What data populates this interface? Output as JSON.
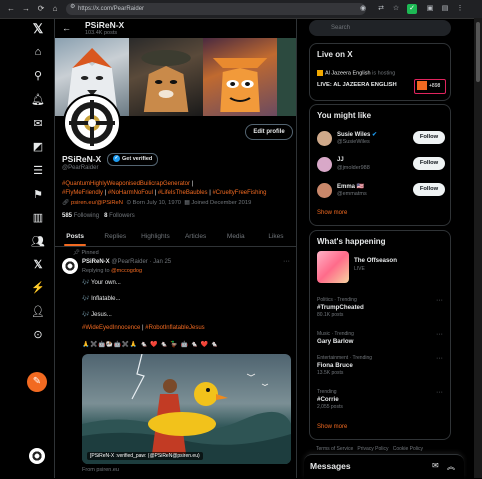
{
  "browser": {
    "url": "https://x.com/PearRaider"
  },
  "header": {
    "name": "PSiReN-X",
    "posts_count": "103.4K posts"
  },
  "profile": {
    "name": "PSiReN-X",
    "verified_label": "Get verified",
    "handle": "@PearRaider",
    "edit_label": "Edit profile",
    "bio_tags": [
      "#QuantumHighlyWeaponisedBuilicrapGenerator",
      "#FlyMeFriendly",
      "#NoHarmNoFoul",
      "#LifeIsTheBaubles",
      "#CrueltyFreeFishing"
    ],
    "website": "psiren.eu/@PSiReN",
    "born": "Born July 10, 1970",
    "joined": "Joined December 2019",
    "following_count": "585",
    "following_label": "Following",
    "followers_count": "8",
    "followers_label": "Followers"
  },
  "tabs": [
    {
      "label": "Posts",
      "active": true
    },
    {
      "label": "Replies"
    },
    {
      "label": "Highlights"
    },
    {
      "label": "Articles"
    },
    {
      "label": "Media"
    },
    {
      "label": "Likes"
    }
  ],
  "post": {
    "pinned_label": "Pinned",
    "author": "PSiReN-X",
    "handle_time": "@PearRaider · Jan 25",
    "replying_prefix": "Replying to",
    "replying_to": "@mccogdog",
    "lines": [
      "🎶 Your own...",
      "🎶 Inflatable...",
      "🎶 Jesus..."
    ],
    "hashtags": [
      "#WideEyedInnocence",
      "#RobotInflatableJesus"
    ],
    "emoji_row": "🙏✖️🤖🐏🤖✖️🙏 🐁 ❤️ 🐁 🦆 🤖 🐁 ❤️ 🐁",
    "image_caption": "[PSiReN-X :verified_paw: (@PSiReN@psiren.eu)",
    "from": "From psiren.eu"
  },
  "search": {
    "placeholder": "Search"
  },
  "live": {
    "title": "Live on X",
    "host": "Al Jazeera English",
    "host_status": "is hosting",
    "show_title": "LIVE: AL JAZEERA ENGLISH",
    "listeners": "+898"
  },
  "suggestions": {
    "title": "You might like",
    "items": [
      {
        "name": "Susie Wiles",
        "handle": "@SusieWiles",
        "follow": "Follow"
      },
      {
        "name": "JJ",
        "handle": "@jmolder988",
        "follow": "Follow"
      },
      {
        "name": "Emma 🇺🇸",
        "handle": "@emmatms",
        "follow": "Follow"
      }
    ],
    "show_more": "Show more"
  },
  "happening": {
    "title": "What's happening",
    "featured": {
      "name": "The Offseason",
      "status": "LIVE"
    },
    "trends": [
      {
        "category": "Politics · Trending",
        "topic": "#TrumpCheated",
        "count": "80.1K posts"
      },
      {
        "category": "Music · Trending",
        "topic": "Gary Barlow",
        "count": ""
      },
      {
        "category": "Entertainment · Trending",
        "topic": "Fiona Bruce",
        "count": "13.5K posts"
      },
      {
        "category": "Trending",
        "topic": "#Corrie",
        "count": "2,055 posts"
      }
    ],
    "show_more": "Show more"
  },
  "footer": {
    "links": [
      "Terms of Service",
      "Privacy Policy",
      "Cookie Policy"
    ]
  },
  "messages": {
    "title": "Messages"
  },
  "colors": {
    "accent": "#f26a21",
    "verified": "#1d9bf0",
    "background": "#000000"
  }
}
